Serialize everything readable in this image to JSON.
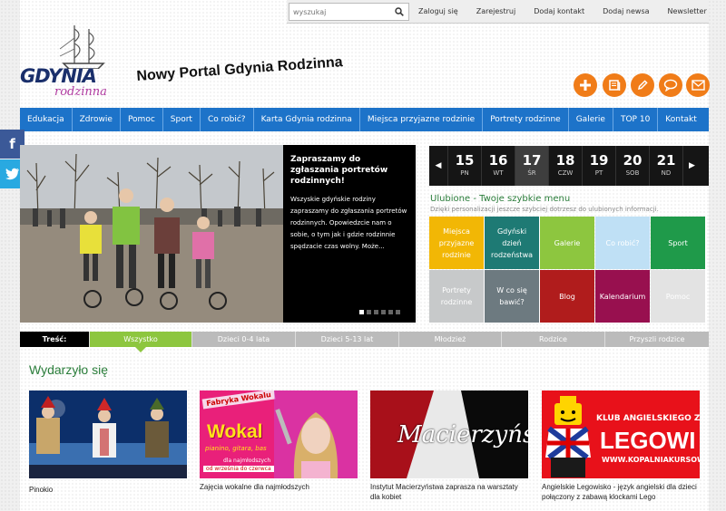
{
  "topbar": {
    "search_placeholder": "wyszukaj",
    "links": [
      "Zaloguj się",
      "Zarejestruj",
      "Dodaj kontakt",
      "Dodaj newsa",
      "Newsletter"
    ]
  },
  "logo": {
    "main": "GDYNIA",
    "sub": "rodzinna"
  },
  "portal_title": "Nowy Portal Gdynia Rodzinna",
  "icons": [
    "plus-icon",
    "book-icon",
    "pencil-icon",
    "chat-icon",
    "mail-icon"
  ],
  "nav": [
    "Edukacja",
    "Zdrowie",
    "Pomoc",
    "Sport",
    "Co robić?",
    "Karta Gdynia rodzinna",
    "Miejsca przyjazne rodzinie",
    "Portrety rodzinne",
    "Galerie",
    "TOP 10",
    "Kontakt"
  ],
  "social": {
    "facebook": "f",
    "twitter": "t"
  },
  "slider": {
    "heading": "Zapraszamy do zgłaszania portretów rodzinnych!",
    "text": "Wszyskie gdyńskie rodziny zapraszamy do zgłaszania portretów rodzinnych. Opowiedzcie nam o sobie, o tym jak i gdzie rodzinnie spędzacie czas wolny. Może...",
    "dots": 6
  },
  "calendar": {
    "days": [
      {
        "d": "15",
        "w": "PN"
      },
      {
        "d": "16",
        "w": "WT"
      },
      {
        "d": "17",
        "w": "ŚR",
        "selected": true
      },
      {
        "d": "18",
        "w": "CZW"
      },
      {
        "d": "19",
        "w": "PT"
      },
      {
        "d": "20",
        "w": "SOB"
      },
      {
        "d": "21",
        "w": "ND"
      }
    ]
  },
  "favorites": {
    "title": "Ulubione - Twoje szybkie menu",
    "subtitle": "Dzięki personalizacji jeszcze szybciej dotrzesz do ulubionych informacji.",
    "tiles": [
      {
        "label": "Miejsca przyjazne rodzinie",
        "color": "#f2b705"
      },
      {
        "label": "Gdyński dzień rodzeństwa",
        "color": "#1e7a74"
      },
      {
        "label": "Galerie",
        "color": "#8dc63f"
      },
      {
        "label": "Co robić?",
        "color": "#bfe0f5"
      },
      {
        "label": "Sport",
        "color": "#1f9a4a"
      },
      {
        "label": "Portrety rodzinne",
        "color": "#c7c9ca"
      },
      {
        "label": "W co się bawić?",
        "color": "#6d7a80"
      },
      {
        "label": "Blog",
        "color": "#b01c1c"
      },
      {
        "label": "Kalendarium",
        "color": "#98104f"
      },
      {
        "label": "Pomoc",
        "color": "#e3e3e3"
      }
    ]
  },
  "tabs": {
    "label": "Treść:",
    "items": [
      "Wszystko",
      "Dzieci 0-4 lata",
      "Dzieci 5-13 lat",
      "Młodzież",
      "Rodzice",
      "Przyszli rodzice"
    ],
    "active": "Wszystko"
  },
  "section_title": "Wydarzyło się",
  "cards": [
    {
      "caption": "Pinokio"
    },
    {
      "caption": "Zajęcia wokalne dla najmłodszych",
      "img_text": {
        "top": "Fabryka Wokalu",
        "big": "Wokal",
        "line": "pianino, gitara, bas",
        "small1": "dla najmłodszych",
        "small2": "od września do czerwca"
      }
    },
    {
      "caption": "Instytut Macierzyństwa zaprasza na warsztaty dla kobiet",
      "img_text": {
        "script": "Macierzyństwo"
      }
    },
    {
      "caption": "Angielskie Legowisko - język angielski dla dzieci połączony z zabawą klockami Lego",
      "img_text": {
        "club": "KLUB ANGIELSKIEGO Z KLOCKAMI",
        "big": "LEGOWI",
        "url": "WWW.KOPALNIAKURSOW.PL"
      }
    }
  ]
}
